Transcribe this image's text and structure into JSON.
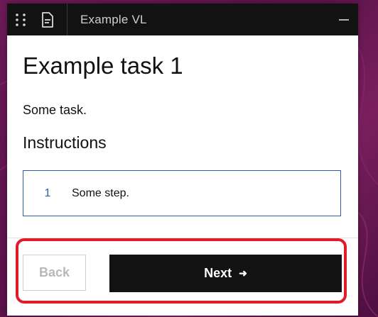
{
  "window": {
    "title": "Example VL"
  },
  "task": {
    "title": "Example task 1",
    "description": "Some task.",
    "instructions_heading": "Instructions",
    "steps": [
      {
        "number": "1",
        "text": "Some step."
      }
    ]
  },
  "footer": {
    "back_label": "Back",
    "next_label": "Next",
    "next_arrow": "➜"
  },
  "colors": {
    "titlebar_bg": "#121212",
    "accent_blue": "#2a5caa",
    "highlight_red": "#e01b2a",
    "next_bg": "#121212"
  },
  "icons": {
    "menu": "drag-dots-icon",
    "document": "document-icon",
    "minimize": "minimize-icon",
    "next": "arrow-right-icon"
  }
}
